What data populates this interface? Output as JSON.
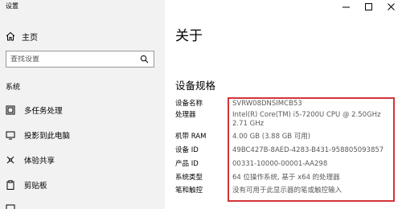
{
  "window": {
    "title": "设置"
  },
  "sidebar": {
    "home_label": "主页",
    "search_placeholder": "查找设置",
    "section_label": "系统",
    "items": [
      {
        "label": "多任务处理",
        "icon": "multitasking-icon"
      },
      {
        "label": "投影到此电脑",
        "icon": "project-icon"
      },
      {
        "label": "体验共享",
        "icon": "shared-experiences-icon"
      },
      {
        "label": "剪贴板",
        "icon": "clipboard-icon"
      }
    ]
  },
  "main": {
    "page_title": "关于",
    "section_title": "设备规格",
    "specs": [
      {
        "key": "设备名称",
        "value": "SVRW08DNSIMCB53"
      },
      {
        "key": "处理器",
        "value": "Intel(R) Core(TM) i5-7200U CPU @ 2.50GHz   2.71 GHz"
      },
      {
        "key": "机带 RAM",
        "value": "4.00 GB (3.88 GB 可用)"
      },
      {
        "key": "设备 ID",
        "value": "49BC427B-8AED-4283-B431-958805093857"
      },
      {
        "key": "产品 ID",
        "value": "00331-10000-00001-AA298"
      },
      {
        "key": "系统类型",
        "value": "64 位操作系统, 基于 x64 的处理器"
      },
      {
        "key": "笔和触控",
        "value": "没有可用于此显示器的笔或触控输入"
      }
    ]
  },
  "colors": {
    "highlight": "#d13438",
    "sidebar_bg": "#f2f2f2"
  }
}
